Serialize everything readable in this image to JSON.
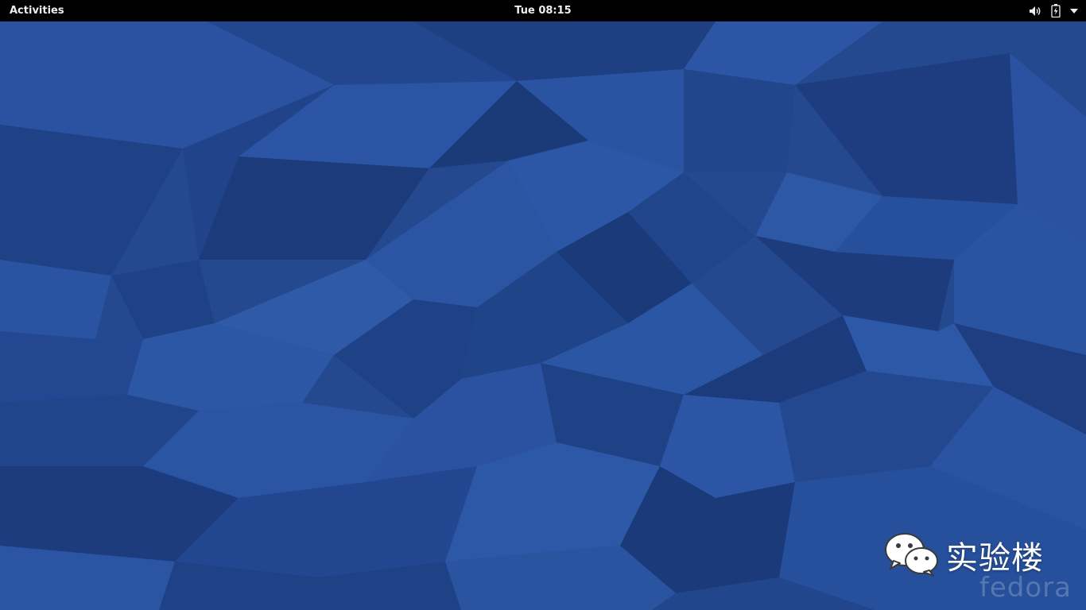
{
  "top_bar": {
    "activities_label": "Activities",
    "clock": "Tue 08:15",
    "tray": {
      "volume_icon": "speaker-icon",
      "battery_icon": "battery-charging-icon",
      "menu_icon": "triangle-down-icon"
    }
  },
  "desktop": {
    "wallpaper": "fedora-blue-polygons",
    "watermark_text": "实验楼",
    "watermark_icon": "wechat-icon",
    "wallpaper_logo": "fedora"
  },
  "colors": {
    "top_bar": "#000000",
    "top_bar_text": "#eeeeec",
    "wallpaper_base": "#24498f",
    "wallpaper_dark": "#1b3a78",
    "wallpaper_light": "#2d57a3"
  }
}
